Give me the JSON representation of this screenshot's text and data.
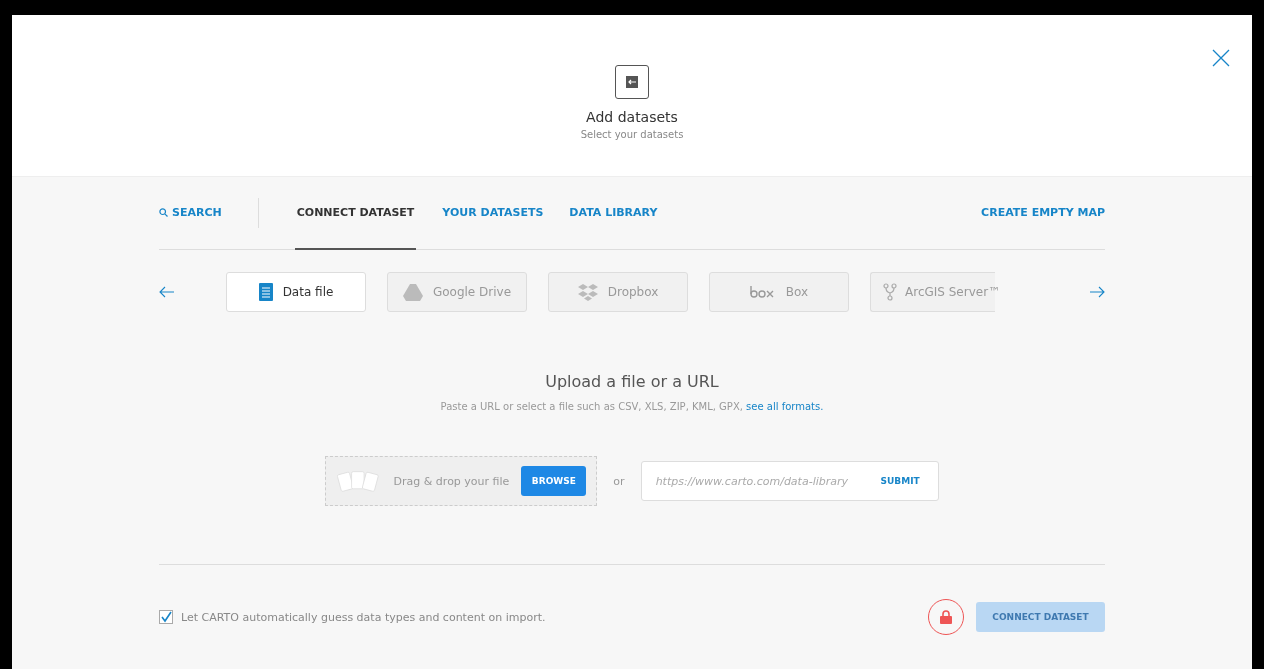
{
  "dialog": {
    "title": "Add datasets",
    "subtitle": "Select your datasets"
  },
  "tabs": [
    {
      "label": "SEARCH",
      "kind": "search",
      "selected": false
    },
    {
      "label": "CONNECT DATASET",
      "kind": "tab",
      "selected": true
    },
    {
      "label": "YOUR DATASETS",
      "kind": "tab",
      "selected": false
    },
    {
      "label": "DATA LIBRARY",
      "kind": "tab",
      "selected": false
    }
  ],
  "create_empty_map": "CREATE EMPTY MAP",
  "sources": [
    {
      "label": "Data file",
      "kind": "file",
      "selected": true
    },
    {
      "label": "Google Drive",
      "kind": "drive",
      "selected": false
    },
    {
      "label": "Dropbox",
      "kind": "dropbox",
      "selected": false
    },
    {
      "label": "Box",
      "kind": "box",
      "selected": false
    },
    {
      "label": "ArcGIS Server™",
      "kind": "arcgis",
      "selected": false
    }
  ],
  "upload": {
    "title": "Upload a file or a URL",
    "description": "Paste a URL or select a file such as CSV, XLS, ZIP, KML, GPX, ",
    "link": "see all formats.",
    "drop_label": "Drag & drop your file",
    "browse": "BROWSE",
    "or": "or",
    "url_placeholder": "https://www.carto.com/data-library",
    "submit": "SUBMIT"
  },
  "footer": {
    "guess_types": {
      "label": "Let CARTO automatically guess data types and content on import.",
      "checked": true
    },
    "connect": {
      "label": "CONNECT DATASET",
      "disabled": true
    }
  }
}
